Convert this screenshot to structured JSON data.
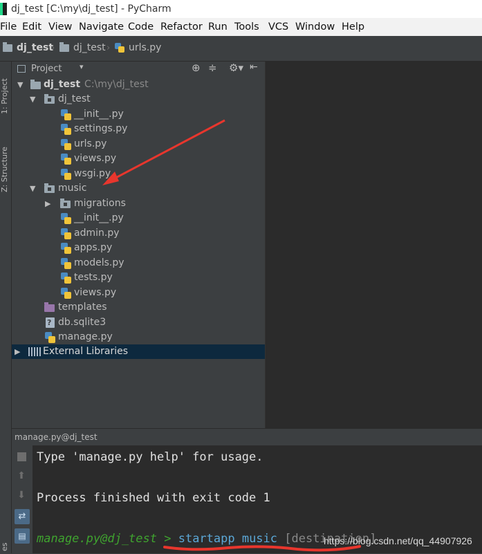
{
  "window": {
    "title": "dj_test [C:\\my\\dj_test] - PyCharm"
  },
  "menu": [
    "File",
    "Edit",
    "View",
    "Navigate",
    "Code",
    "Refactor",
    "Run",
    "Tools",
    "VCS",
    "Window",
    "Help"
  ],
  "breadcrumb": {
    "items": [
      "dj_test",
      "dj_test",
      "urls.py"
    ]
  },
  "side_tabs": {
    "project": "1: Project",
    "structure": "Z: Structure",
    "bottom": "es"
  },
  "project_panel": {
    "title": "Project"
  },
  "tree": {
    "root": {
      "name": "dj_test",
      "path": "C:\\my\\dj_test"
    },
    "pkg1": {
      "name": "dj_test",
      "files": [
        "__init__.py",
        "settings.py",
        "urls.py",
        "views.py",
        "wsgi.py"
      ]
    },
    "pkg2": {
      "name": "music",
      "subdir": "migrations",
      "files": [
        "__init__.py",
        "admin.py",
        "apps.py",
        "models.py",
        "tests.py",
        "views.py"
      ]
    },
    "templates": "templates",
    "db": "db.sqlite3",
    "manage": "manage.py",
    "external": "External Libraries"
  },
  "run_panel": {
    "title": "manage.py@dj_test"
  },
  "console": {
    "line1": "Type 'manage.py help' for usage.",
    "line2": "Process finished with exit code 1",
    "prompt": "manage.py@dj_test",
    "prompt_sep": " > ",
    "command": "startapp music",
    "hint": " [destination]"
  },
  "watermark": "https://blog.csdn.net/qq_44907926",
  "colors": {
    "selection": "#0d293e",
    "annotation": "#e8362d",
    "prompt": "#3fa32f",
    "command": "#5ba7d6"
  }
}
